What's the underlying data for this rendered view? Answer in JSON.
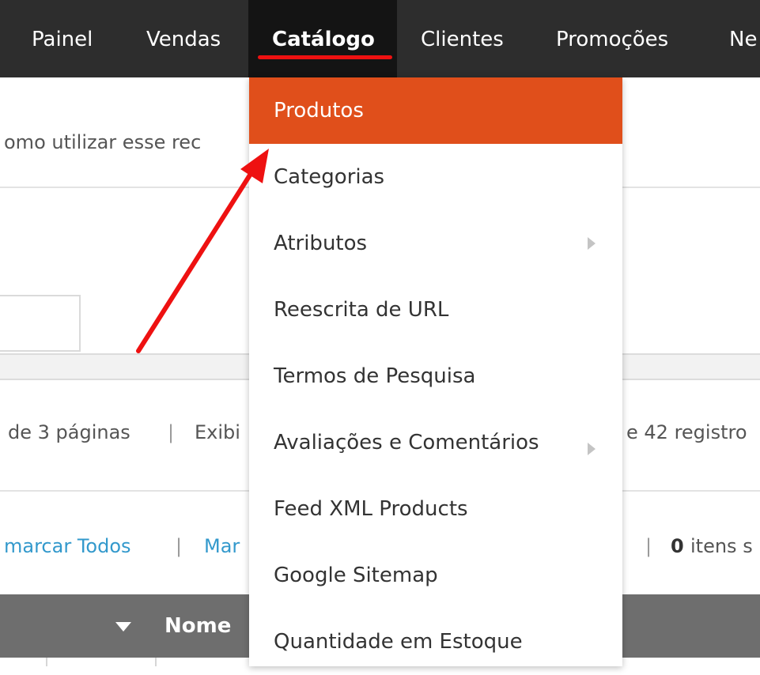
{
  "nav": {
    "items": [
      {
        "label": "Painel"
      },
      {
        "label": "Vendas"
      },
      {
        "label": "Catálogo"
      },
      {
        "label": "Clientes"
      },
      {
        "label": "Promoções"
      },
      {
        "label": "Ne"
      }
    ],
    "active_index": 2
  },
  "dropdown": {
    "items": [
      {
        "label": "Produtos"
      },
      {
        "label": "Categorias"
      },
      {
        "label": "Atributos"
      },
      {
        "label": "Reescrita de URL"
      },
      {
        "label": "Termos de Pesquisa"
      },
      {
        "label": "Avaliações e Comentários"
      },
      {
        "label": "Feed XML Products"
      },
      {
        "label": "Google Sitemap"
      },
      {
        "label": "Quantidade em Estoque"
      }
    ],
    "highlighted_index": 0,
    "highlight_color": "#e04f1b"
  },
  "page": {
    "help_text": "omo utilizar esse rec",
    "pager_left": "de 3 páginas",
    "pager_sep": "|",
    "pager_mid": "Exibi",
    "pager_right": "e 42 registro",
    "select_all": "marcar Todos",
    "select_sep": "|",
    "select_mark": "Mar",
    "selected_sep": "|",
    "selected_count": "0",
    "selected_suffix": "itens s",
    "col_name": "Nome"
  },
  "annotation": {
    "arrow_color": "#ee1111"
  }
}
